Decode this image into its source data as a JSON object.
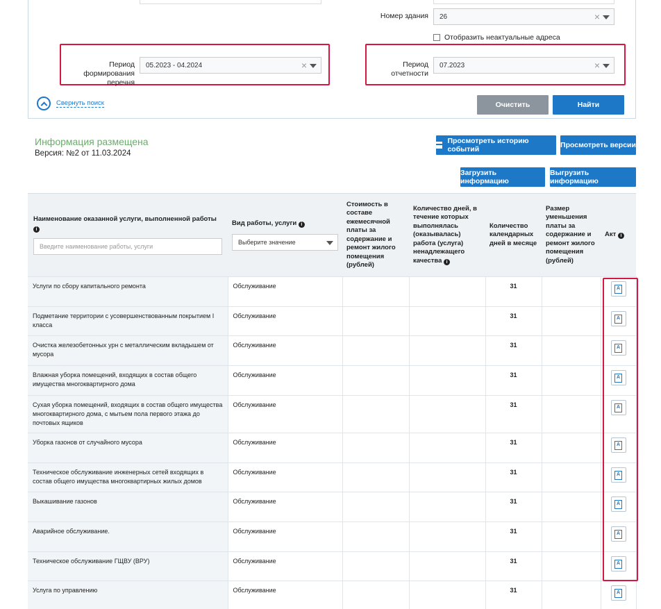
{
  "filters": {
    "building_number_label": "Номер здания",
    "building_number_value": "26",
    "show_inactive_label": "Отобразить неактуальные адреса",
    "period_label": "Период формирования перечня",
    "period_value": "05.2023 - 04.2024",
    "report_period_label": "Период отчетности",
    "report_period_value": "07.2023",
    "collapse_label": "Свернуть поиск",
    "clear_label": "Очистить",
    "find_label": "Найти"
  },
  "info": {
    "title": "Информация размещена",
    "version": "Версия: №2 от 11.03.2024",
    "history_label": "Просмотреть историю событий",
    "versions_label": "Просмотреть версии",
    "upload_label": "Загрузить информацию",
    "download_label": "Выгрузить информацию"
  },
  "table": {
    "headers": {
      "name": "Наименование оказанной услуги, выполненной работы",
      "name_placeholder": "Введите наименование работы, услуги",
      "type": "Вид работы, услуги",
      "type_placeholder": "Выберите значение",
      "cost": "Стоимость в составе ежемесячной платы за содержание и ремонт жилого помещения (рублей)",
      "bad_days": "Количество дней, в течение которых выполнялась (оказывалась) работа (услуга) ненадлежащего качества",
      "cal_days": "Количество календарных дней в месяце",
      "reduction": "Размер уменьшения платы за содержание и ремонт жилого помещения (рублей)",
      "act": "Акт"
    },
    "rows": [
      {
        "name": "Услуги по сбору капитального ремонта",
        "type": "Обслуживание",
        "days": "31"
      },
      {
        "name": "Подметание территории с усовершенствованным покрытием I класса",
        "type": "Обслуживание",
        "days": "31"
      },
      {
        "name": "Очистка железобетонных урн с металлическим вкладышем от мусора",
        "type": "Обслуживание",
        "days": "31"
      },
      {
        "name": "Влажная уборка помещений, входящих в состав общего имущества многоквартирного дома",
        "type": "Обслуживание",
        "days": "31"
      },
      {
        "name": "Сухая уборка помещений, входящих в состав общего имущества многоквартирного дома, с мытьем пола первого этажа до почтовых ящиков",
        "type": "Обслуживание",
        "days": "31"
      },
      {
        "name": "Уборка газонов от случайного мусора",
        "type": "Обслуживание",
        "days": "31"
      },
      {
        "name": "Техническое обслуживание инженерных сетей входящих в состав общего имущества многоквартирных жилых домов",
        "type": "Обслуживание",
        "days": "31"
      },
      {
        "name": "Выкашивание газонов",
        "type": "Обслуживание",
        "days": "31"
      },
      {
        "name": "Аварийное обслуживание.",
        "type": "Обслуживание",
        "days": "31"
      },
      {
        "name": "Техническое обслуживание ГЩВУ (ВРУ)",
        "type": "Обслуживание",
        "days": "31"
      },
      {
        "name": "Услуга по управлению",
        "type": "Обслуживание",
        "days": "31"
      }
    ]
  }
}
